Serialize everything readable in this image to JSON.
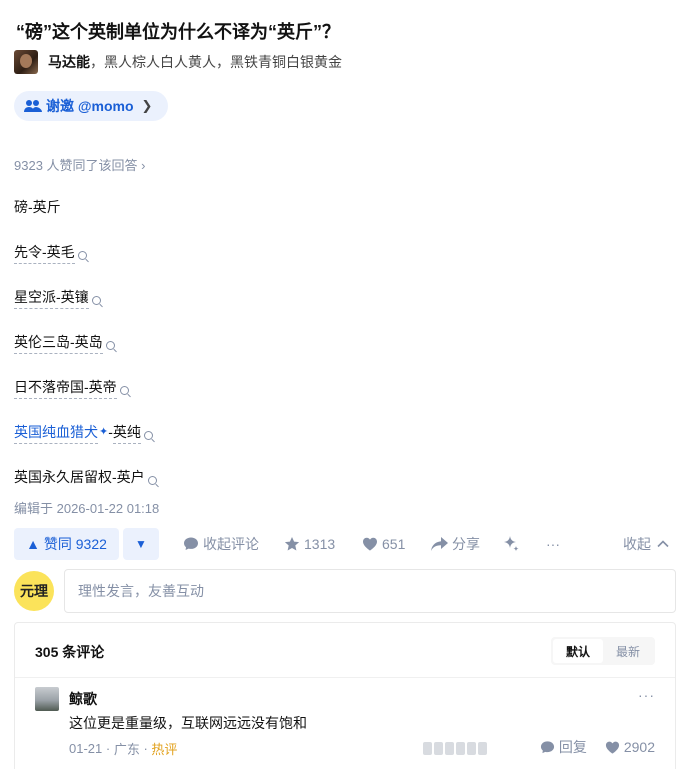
{
  "question": {
    "title": "“磅”这个英制单位为什么不译为“英斤”？"
  },
  "author": {
    "name": "马达能",
    "bio": "，黑人棕人白人黄人，黑铁青铜白银黄金"
  },
  "invite": {
    "label": "谢邀 @momo",
    "chevron": "❯"
  },
  "upvote_summary": "9323 人赞同了该回答 ›",
  "answer_lines": [
    {
      "text": "磅-英斤"
    },
    {
      "text": "先令-英毛"
    },
    {
      "text": "星空派-英镶"
    },
    {
      "text": "英伦三岛-英岛"
    },
    {
      "text": "日不落帝国-英帝"
    },
    {
      "link": "英国纯血猎犬",
      "spark": "✦",
      "rest_prefix": "-",
      "rest_link": "英纯"
    },
    {
      "text": "英国永久居留权-英户"
    }
  ],
  "edit_time": "编辑于 2026-01-22 01:18",
  "actions": {
    "upvote_label": "▲ 赞同 9322",
    "downvote_label": "▼",
    "comment_label": "收起评论",
    "favorite_count": "1313",
    "like_count": "651",
    "share_label": "分享",
    "more_label": "···",
    "collapse_label": "收起"
  },
  "reply": {
    "avatar_text": "元理",
    "placeholder": "理性发言，友善互动"
  },
  "comments": {
    "count_label": "305 条评论",
    "sort_default": "默认",
    "sort_latest": "最新",
    "items": [
      {
        "user": "鲸歌",
        "text": "这位更是重量级，互联网远远没有饱和",
        "date": "01-21",
        "location": "广东",
        "tag": "热评",
        "reply_label": "回复",
        "likes": "2902",
        "more": "···"
      }
    ]
  },
  "colors": {
    "accent": "#1a5fd6",
    "accent_bg": "#ebf1fd",
    "muted": "#8590a6",
    "hot": "#e2a21e",
    "avatar_yellow": "#fbe35a"
  }
}
